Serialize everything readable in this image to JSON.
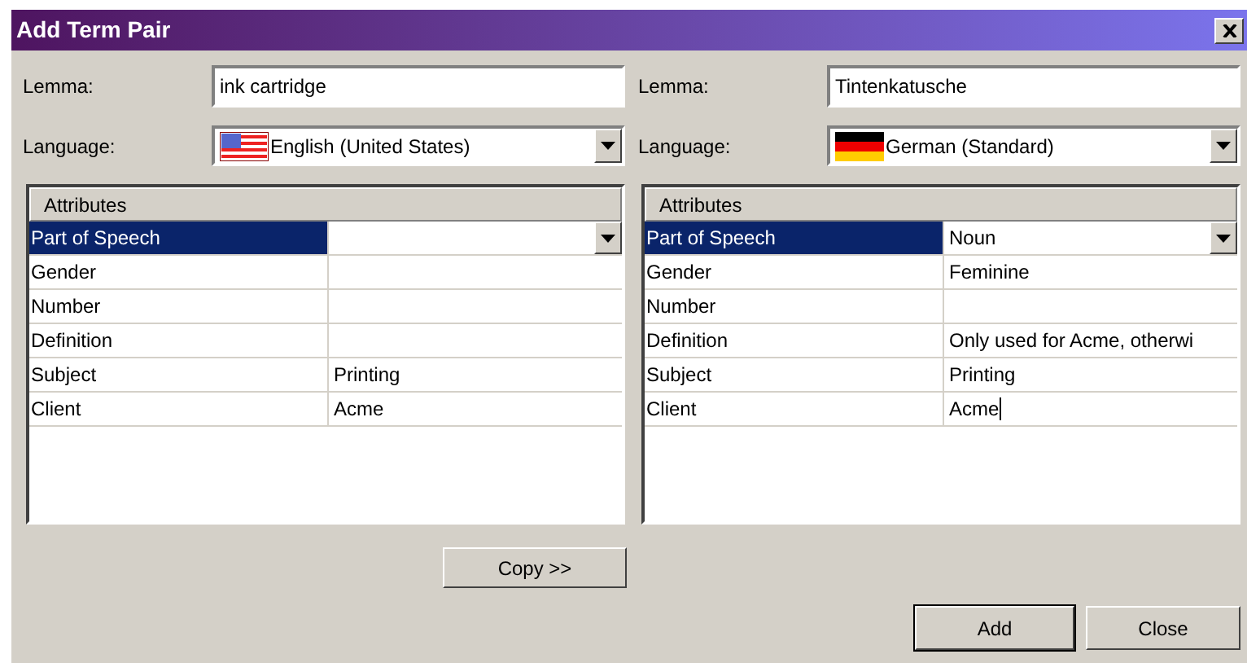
{
  "window": {
    "title": "Add Term Pair"
  },
  "panes": [
    {
      "lemma_label": "Lemma:",
      "lemma": "ink cartridge",
      "language_label": "Language:",
      "language": "English (United States)",
      "flag": {
        "kind": "us"
      },
      "attributes_header": "Attributes",
      "rows": [
        {
          "name": "Part of Speech",
          "kind": "dropdown",
          "selected": true,
          "editing": false
        },
        {
          "name": "Gender",
          "kind": "text",
          "selected": false,
          "editing": false
        },
        {
          "name": "Number",
          "kind": "text",
          "selected": false,
          "editing": false
        },
        {
          "name": "Definition",
          "kind": "text",
          "selected": false,
          "editing": false
        },
        {
          "name": "Subject",
          "value": "Printing",
          "kind": "text",
          "selected": false,
          "editing": false
        },
        {
          "name": "Client",
          "value": "Acme",
          "kind": "text",
          "selected": false,
          "editing": false
        }
      ]
    },
    {
      "lemma_label": "Lemma:",
      "lemma": "Tintenkatusche",
      "language_label": "Language:",
      "language": "German (Standard)",
      "flag": {
        "kind": "de"
      },
      "attributes_header": "Attributes",
      "rows": [
        {
          "name": "Part of Speech",
          "value": "Noun",
          "kind": "dropdown",
          "selected": true,
          "editing": false
        },
        {
          "name": "Gender",
          "value": "Feminine",
          "kind": "text",
          "selected": false,
          "editing": false
        },
        {
          "name": "Number",
          "kind": "text",
          "selected": false,
          "editing": false
        },
        {
          "name": "Definition",
          "value": "Only used for Acme, otherwi",
          "kind": "text",
          "selected": false,
          "editing": false
        },
        {
          "name": "Subject",
          "value": "Printing",
          "kind": "text",
          "selected": false,
          "editing": false
        },
        {
          "name": "Client",
          "value": "Acme",
          "kind": "text",
          "selected": false,
          "editing": true
        }
      ]
    }
  ],
  "copy_button": {
    "label": "Copy >>"
  },
  "buttons": [
    {
      "label": "Add",
      "default": true
    },
    {
      "label": "Close",
      "default": false
    }
  ]
}
